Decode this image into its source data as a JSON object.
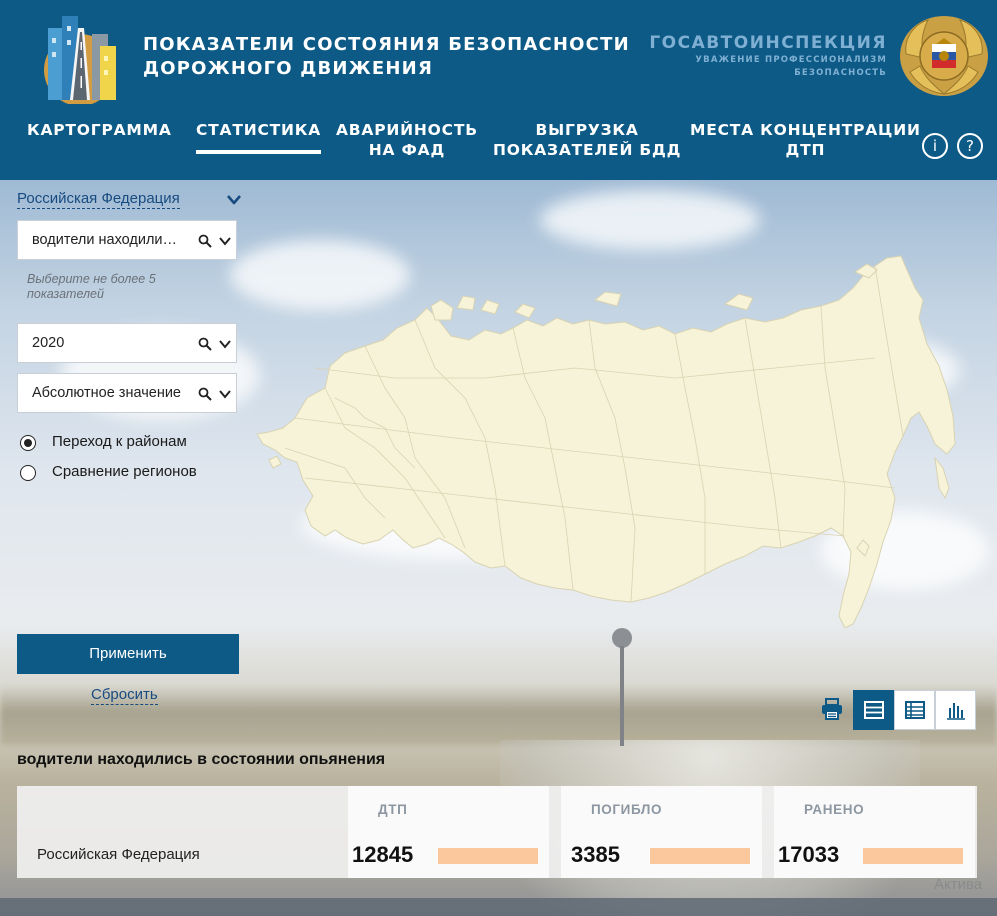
{
  "header": {
    "title_line1": "ПОКАЗАТЕЛИ СОСТОЯНИЯ БЕЗОПАСНОСТИ",
    "title_line2": "ДОРОЖНОГО ДВИЖЕНИЯ",
    "brand": "ГОСАВТОИНСПЕКЦИЯ",
    "motto_line1": "УВАЖЕНИЕ ПРОФЕССИОНАЛИЗМ",
    "motto_line2": "БЕЗОПАСНОСТЬ",
    "info_icon": "i",
    "help_icon": "?"
  },
  "nav": [
    {
      "line1": "КАРТОГРАММА",
      "line2": ""
    },
    {
      "line1": "СТАТИСТИКА",
      "line2": "",
      "active": true
    },
    {
      "line1": "АВАРИЙНОСТЬ",
      "line2": "НА ФАД"
    },
    {
      "line1": "ВЫГРУЗКА",
      "line2": "ПОКАЗАТЕЛЕЙ БДД"
    },
    {
      "line1": "МЕСТА КОНЦЕНТРАЦИИ",
      "line2": "ДТП"
    }
  ],
  "filters": {
    "region": "Российская Федерация",
    "indicator": "водители находились в состоянии опьянения",
    "hint": "Выберите не более 5 показателей",
    "year": "2020",
    "value_type": "Абсолютное значение",
    "radios": [
      {
        "label": "Переход к районам",
        "checked": true
      },
      {
        "label": "Сравнение регионов",
        "checked": false
      }
    ],
    "apply": "Применить",
    "reset": "Сбросить"
  },
  "results": {
    "title": "водители находились в состоянии опьянения",
    "columns": [
      "ДТП",
      "ПОГИБЛО",
      "РАНЕНО"
    ],
    "rows": [
      {
        "region": "Российская Федерация",
        "values": [
          "12845",
          "3385",
          "17033"
        ]
      }
    ]
  },
  "colors": {
    "primary": "#0d5a86",
    "bar": "#fbc79c",
    "map_fill": "#f7f3d8"
  },
  "watermark": "Актива"
}
